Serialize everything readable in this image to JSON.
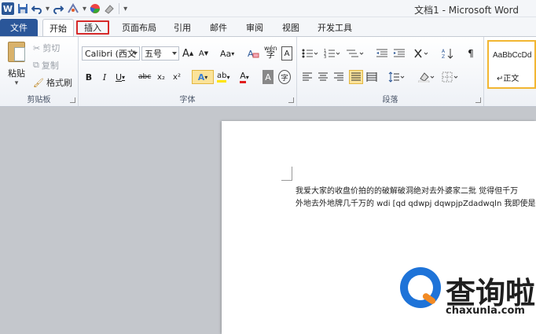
{
  "window": {
    "title": "文档1 - Microsoft Word"
  },
  "qat": {
    "logo": "W"
  },
  "tabs": [
    {
      "label": "文件"
    },
    {
      "label": "开始"
    },
    {
      "label": "插入"
    },
    {
      "label": "页面布局"
    },
    {
      "label": "引用"
    },
    {
      "label": "邮件"
    },
    {
      "label": "审阅"
    },
    {
      "label": "视图"
    },
    {
      "label": "开发工具"
    }
  ],
  "clipboard": {
    "paste": "粘贴",
    "cut": "剪切",
    "copy": "复制",
    "format_painter": "格式刷",
    "label": "剪贴板"
  },
  "font": {
    "family": "Calibri (西文",
    "size": "五号",
    "grow": "A",
    "shrink": "A",
    "case": "Aa",
    "bold": "B",
    "italic": "I",
    "underline": "U",
    "strike": "abc",
    "subscript": "x₂",
    "superscript": "x²",
    "text_effect": "A",
    "highlight": "ab",
    "font_color": "A",
    "char_shade": "A",
    "enclose": "字",
    "phonetic": "wén",
    "border_char": "A",
    "label": "字体"
  },
  "paragraph": {
    "label": "段落"
  },
  "styles": {
    "sample": "AaBbCcDd",
    "name": "正文"
  },
  "document": {
    "line1": "我爱大家的收盘价拍的的破解破洞绝对去外婆家二批 觉得但千万",
    "line2": "外地去外地牌几千万的 wdi [qd qdwpj dqwpjpZdadwqln 我即使是"
  },
  "watermark": {
    "cn": "查询啦",
    "url": "chaxunla.com"
  },
  "colors": {
    "file_tab": "#2a5699",
    "highlight_box": "#d62a2a",
    "style_border": "#f2b632"
  }
}
